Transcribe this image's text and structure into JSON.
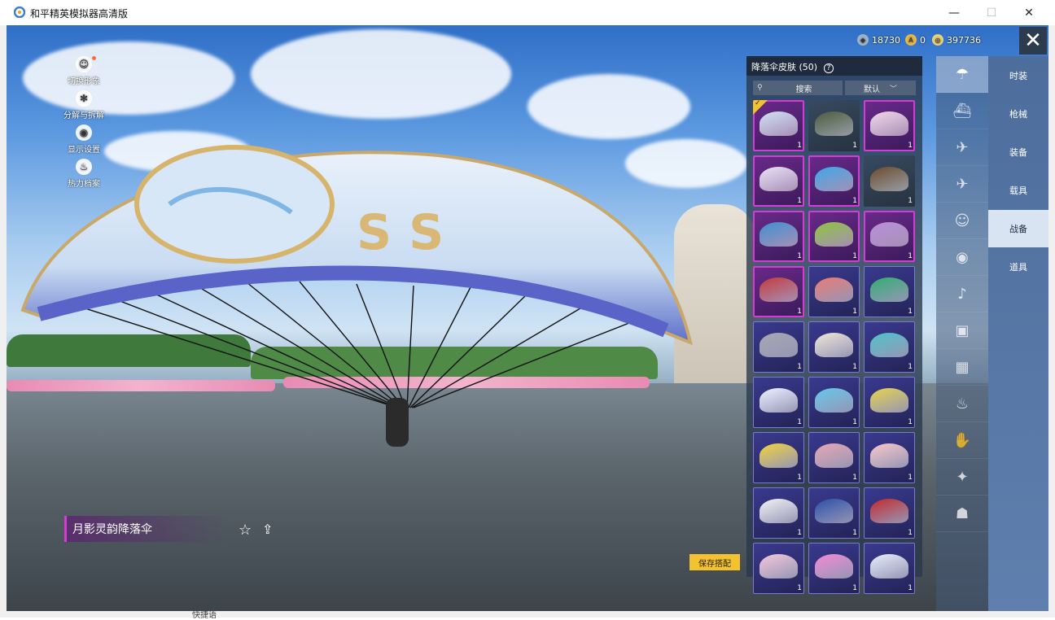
{
  "window": {
    "title": "和平精英模拟器高清版",
    "min": "—",
    "max": "☐",
    "close": "✕"
  },
  "left_menu": [
    {
      "label": "切换形象",
      "icon": "avatar-icon"
    },
    {
      "label": "分解与拆解",
      "icon": "gear-icon"
    },
    {
      "label": "显示设置",
      "icon": "eye-icon"
    },
    {
      "label": "热力档案",
      "icon": "flame-icon"
    }
  ],
  "currency": [
    {
      "value": "18730",
      "icon": "medal-coin-icon",
      "color": "#9fb3c8"
    },
    {
      "value": "0",
      "icon": "gold-coin-icon",
      "color": "#e6b84a"
    },
    {
      "value": "397736",
      "icon": "silver-coin-icon",
      "color": "#e8d27a"
    }
  ],
  "close_symbol": "✕",
  "panel": {
    "title": "降落伞皮肤 (50)",
    "help": "?",
    "search_placeholder": "搜索",
    "sort_label": "默认"
  },
  "skins": [
    {
      "rarity": "epic",
      "color": "#cfe0f4",
      "qty": "1",
      "equipped": true
    },
    {
      "rarity": "plain",
      "color": "#4b5a3c",
      "qty": "1"
    },
    {
      "rarity": "epic",
      "color": "#f2d6e6",
      "qty": "1"
    },
    {
      "rarity": "epic",
      "color": "#e9e2f5",
      "qty": "1"
    },
    {
      "rarity": "epic",
      "color": "#3aa7e6",
      "qty": "1"
    },
    {
      "rarity": "plain",
      "color": "#6b4a2a",
      "qty": "1"
    },
    {
      "rarity": "epic",
      "color": "#3c8fd0",
      "qty": "1"
    },
    {
      "rarity": "epic",
      "color": "#8cc43a",
      "qty": "1"
    },
    {
      "rarity": "epic",
      "color": "#b690d6",
      "qty": "1"
    },
    {
      "rarity": "epic",
      "color": "#c23a3a",
      "qty": "1"
    },
    {
      "rarity": "rare",
      "color": "#e97a72",
      "qty": "1"
    },
    {
      "rarity": "rare",
      "color": "#2fae6e",
      "qty": "1"
    },
    {
      "rarity": "rare",
      "color": "#a6a6b0",
      "qty": "1"
    },
    {
      "rarity": "rare",
      "color": "#f0e6d6",
      "qty": "1"
    },
    {
      "rarity": "rare",
      "color": "#4ec2c8",
      "qty": "1"
    },
    {
      "rarity": "rare",
      "color": "#eef0ff",
      "qty": "1"
    },
    {
      "rarity": "rare",
      "color": "#63c8e6",
      "qty": "1"
    },
    {
      "rarity": "rare",
      "color": "#e7d24a",
      "qty": "1"
    },
    {
      "rarity": "rare",
      "color": "#f0d23a",
      "qty": "1"
    },
    {
      "rarity": "rare",
      "color": "#e8a6b0",
      "qty": "1"
    },
    {
      "rarity": "rare",
      "color": "#f7c6c6",
      "qty": "1"
    },
    {
      "rarity": "rare",
      "color": "#f2f2f2",
      "qty": "1"
    },
    {
      "rarity": "rare",
      "color": "#2a4fa6",
      "qty": "1"
    },
    {
      "rarity": "rare",
      "color": "#c22a2a",
      "qty": "1"
    },
    {
      "rarity": "rare",
      "color": "#f4c6d6",
      "qty": "1"
    },
    {
      "rarity": "rare",
      "color": "#f08ad0",
      "qty": "1"
    },
    {
      "rarity": "rare",
      "color": "#e6eef8",
      "qty": "1"
    }
  ],
  "icon_tabs": [
    {
      "icon": "parachute-icon",
      "glyph": "☂",
      "active": true
    },
    {
      "icon": "boat-icon",
      "glyph": "⛴"
    },
    {
      "icon": "drone-icon",
      "glyph": "✈"
    },
    {
      "icon": "plane-icon",
      "glyph": "✈"
    },
    {
      "icon": "emote-icon",
      "glyph": "☺"
    },
    {
      "icon": "pet-icon",
      "glyph": "◉"
    },
    {
      "icon": "speaker-icon",
      "glyph": "♪"
    },
    {
      "icon": "badge-icon",
      "glyph": "▣"
    },
    {
      "icon": "photo-icon",
      "glyph": "▦"
    },
    {
      "icon": "extinguisher-icon",
      "glyph": "♨"
    },
    {
      "icon": "hand-icon",
      "glyph": "✋"
    },
    {
      "icon": "wand-icon",
      "glyph": "✦"
    },
    {
      "icon": "hat-icon",
      "glyph": "☗"
    }
  ],
  "categories": [
    {
      "label": "时装"
    },
    {
      "label": "枪械"
    },
    {
      "label": "装备"
    },
    {
      "label": "载具"
    },
    {
      "label": "战备",
      "active": true
    },
    {
      "label": "道具"
    }
  ],
  "selected_name": "月影灵韵降落伞",
  "fav_glyph": "☆",
  "share_glyph": "⇪",
  "save_label": "保存搭配",
  "bottom_hint": "快捷语"
}
